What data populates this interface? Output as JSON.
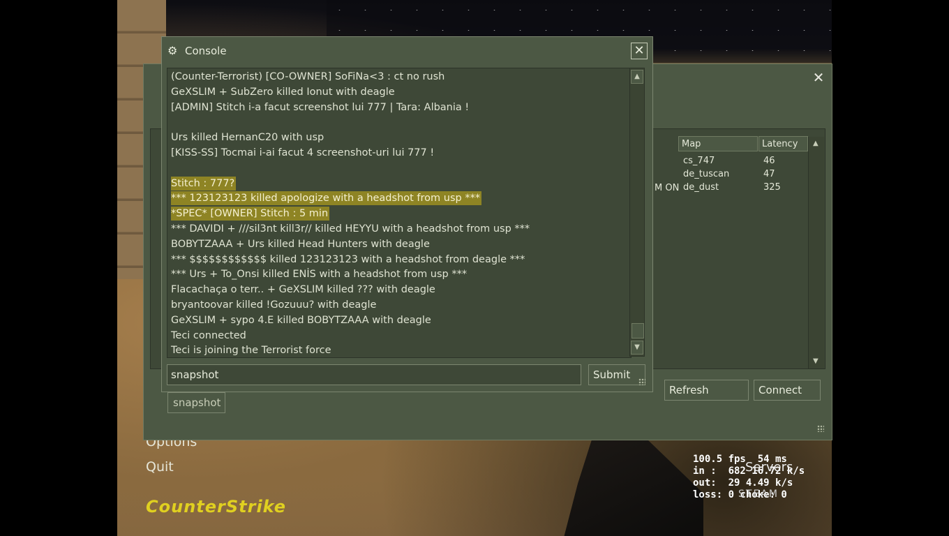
{
  "background": {
    "menu_options": "Options",
    "menu_quit": "Quit",
    "logo_text": "CounterStrike",
    "servers_label": "Servers",
    "steam_label": "STEAM",
    "netstats": {
      "fps": "100.5 fps  54 ms",
      "in": "in :  682 16.72 k/s",
      "out": "out:  29 4.49 k/s",
      "loss": "loss: 0 choke: 0"
    }
  },
  "server_browser": {
    "columns": {
      "map": "Map",
      "latency": "Latency"
    },
    "rows": [
      {
        "map": "cs_747",
        "latency": "46",
        "prefix": ""
      },
      {
        "map": "de_tuscan",
        "latency": "47",
        "prefix": ""
      },
      {
        "map": "de_dust",
        "latency": "325",
        "prefix": "M ON"
      }
    ],
    "buttons": {
      "refresh": "Refresh",
      "connect": "Connect"
    }
  },
  "console": {
    "title": "Console",
    "lines": [
      {
        "text": "(Counter-Terrorist) [CO-OWNER] SoFiNa<3 : ct no rush",
        "highlight": false
      },
      {
        "text": "GeXSLIM + SubZero killed Ionut with deagle",
        "highlight": false
      },
      {
        "text": "[ADMIN] Stitch i-a facut screenshot lui 777 | Tara: Albania !",
        "highlight": false
      },
      {
        "text": "",
        "highlight": false
      },
      {
        "text": "Urs killed HernanC20 with usp",
        "highlight": false
      },
      {
        "text": "[KISS-SS] Tocmai i-ai facut 4 screenshot-uri lui 777 !",
        "highlight": false
      },
      {
        "text": "",
        "highlight": false
      },
      {
        "text": "Stitch :   777?",
        "highlight": true
      },
      {
        "text": "*** 123123123 killed apologize with a headshot from usp ***",
        "highlight": true
      },
      {
        "text": "*SPEC* [OWNER] Stitch : 5 min",
        "highlight": true
      },
      {
        "text": "*** DAVIDI + ///sil3nt kill3r// killed HEYYU with a headshot from usp ***",
        "highlight": false
      },
      {
        "text": "BOBYTZAAA + Urs killed Head Hunters with deagle",
        "highlight": false
      },
      {
        "text": "*** $$$$$$$$$$$$ killed 123123123 with a headshot from deagle ***",
        "highlight": false
      },
      {
        "text": "*** Urs + To_Onsi killed ENİS with a headshot from usp ***",
        "highlight": false
      },
      {
        "text": "Flacachaça o terr.. + GeXSLIM killed ??? with deagle",
        "highlight": false
      },
      {
        "text": "bryantoovar killed !Gozuuu? with deagle",
        "highlight": false
      },
      {
        "text": "GeXSLIM + sypo 4.E killed BOBYTZAAA with deagle",
        "highlight": false
      },
      {
        "text": "Teci connected",
        "highlight": false
      },
      {
        "text": "Teci is joining the Terrorist force",
        "highlight": false
      }
    ],
    "input_value": "snapshot",
    "submit_label": "Submit",
    "autocomplete_suggestion": "snapshot"
  },
  "colors": {
    "panel": "#4c5844",
    "highlight": "#8e8424",
    "logo": "#e0d020"
  }
}
